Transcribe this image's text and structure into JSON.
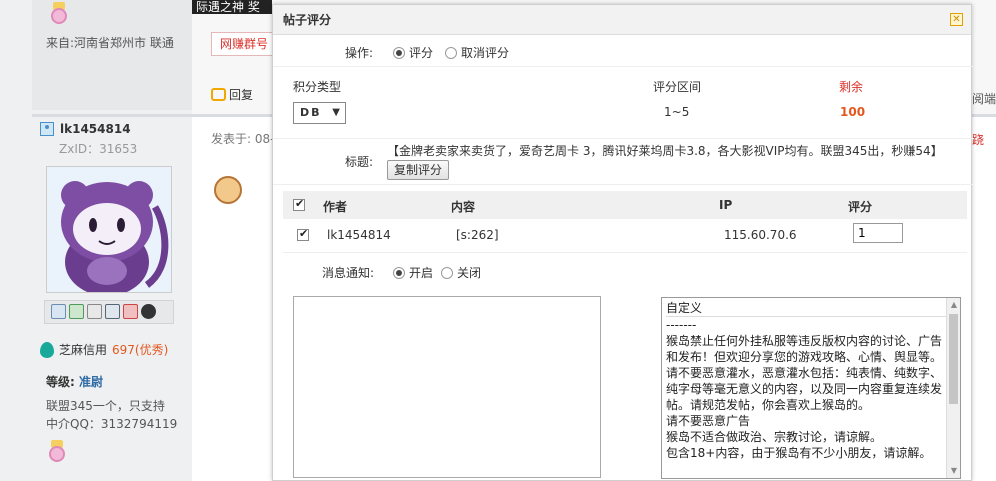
{
  "background": {
    "from_text": "来自:河南省郑州市 联通",
    "username": "lk1454814",
    "zxid": "ZxID：31653",
    "zhima_label": "芝麻信用",
    "zhima_score": "697(优秀)",
    "level_label": "等级:",
    "level_value": "准尉",
    "signature_line1": "联盟345一个，只支持",
    "signature_line2": "中介QQ：3132794119",
    "nav_text": "际遇之神  奖",
    "wzq_button": "网赚群号",
    "reply_label": "回复",
    "posted_label": "发表于: 08-",
    "right_text_1": "阅端",
    "right_text_2": "跷"
  },
  "dialog": {
    "title": "帖子评分",
    "close_icon": "close-icon",
    "operation_label": "操作:",
    "op_rate": "评分",
    "op_cancel": "取消评分",
    "score_type_label": "积分类型",
    "score_range_label": "评分区间",
    "remaining_label": "剩余",
    "score_type_value": "DB",
    "score_range_value": "1~5",
    "remaining_value": "100",
    "title_label": "标题:",
    "title_text": "【金牌老卖家来卖货了，爱奇艺周卡 3，腾讯好莱坞周卡3.8，各大影视VIP均有。联盟345出，秒赚54】",
    "copy_button": "复制评分",
    "table": {
      "col_author": "作者",
      "col_content": "内容",
      "col_ip": "IP",
      "col_score": "评分",
      "row_author": "lk1454814",
      "row_content": "[s:262]",
      "row_ip": "115.60.70.6",
      "row_score": "1"
    },
    "notify_label": "消息通知:",
    "notify_on": "开启",
    "notify_off": "关闭",
    "reasons": [
      "自定义",
      "-------",
      "猴岛禁止任何外挂私服等违反版权内容的讨论、广告和发布！但欢迎分享您的游戏攻略、心情、舆显等。",
      "请不要恶意灌水，恶意灌水包括：纯表情、纯数字、纯字母等毫无意义的内容，以及同一内容重复连续发帖。请规范发帖，你会喜欢上猴岛的。",
      "请不要恶意广告",
      "猴岛不适合做政治、宗教讨论，请谅解。",
      "包含18+内容，由于猴岛有不少小朋友，请谅解。"
    ]
  },
  "colors": {
    "accent_red": "#d9322a",
    "remaining_orange": "#e4571e",
    "level_blue": "#2f6ba5"
  }
}
